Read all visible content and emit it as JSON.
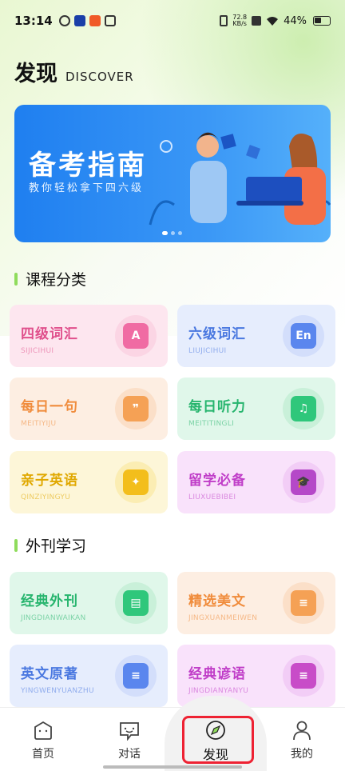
{
  "status": {
    "time": "13:14",
    "net_top": "72.8",
    "net_bottom": "KB/s",
    "battery": "44%"
  },
  "header": {
    "title": "发现",
    "subtitle": "DISCOVER"
  },
  "banner": {
    "title": "备考指南",
    "subtitle": "教你轻松拿下四六级",
    "active_dot": 1
  },
  "sections": [
    {
      "title": "课程分类"
    },
    {
      "title": "外刊学习"
    }
  ],
  "cards": [
    {
      "title": "四级词汇",
      "sub": "SIJICIHUI",
      "icon_text": "A",
      "color": "#e0508c",
      "bg": "#fde6ef",
      "circle": "#fbd5e4",
      "icon_bg": "#f06ba3",
      "icon": "letter-a-icon"
    },
    {
      "title": "六级词汇",
      "sub": "LIUJICIHUI",
      "icon_text": "En",
      "color": "#4a78e0",
      "bg": "#e6edfd",
      "circle": "#d3defb",
      "icon_bg": "#5a86ee",
      "icon": "english-en-icon"
    },
    {
      "title": "每日一句",
      "sub": "MEITIYIJU",
      "icon_text": "❞",
      "color": "#f08c3c",
      "bg": "#fdeee2",
      "circle": "#fbdfc8",
      "icon_bg": "#f5a155",
      "icon": "quote-icon"
    },
    {
      "title": "每日听力",
      "sub": "MEITITINGLI",
      "icon_text": "♫",
      "color": "#27b56e",
      "bg": "#e0f7ea",
      "circle": "#c9f0d9",
      "icon_bg": "#2fc77b",
      "icon": "headphones-icon"
    },
    {
      "title": "亲子英语",
      "sub": "QINZIYINGYU",
      "icon_text": "✦",
      "color": "#e0a800",
      "bg": "#fdf6d8",
      "circle": "#fbedb3",
      "icon_bg": "#f3be1c",
      "icon": "parent-child-icon"
    },
    {
      "title": "留学必备",
      "sub": "LIUXUEBIBEI",
      "icon_text": "🎓",
      "color": "#c03ec8",
      "bg": "#f9e2fb",
      "circle": "#f2cdf6",
      "icon_bg": "#b548c8",
      "icon": "graduation-cap-icon"
    },
    {
      "title": "经典外刊",
      "sub": "JINGDIANWAIKAN",
      "icon_text": "▤",
      "color": "#27b56e",
      "bg": "#e0f7ea",
      "circle": "#c9f0d9",
      "icon_bg": "#2fc77b",
      "icon": "open-book-icon"
    },
    {
      "title": "精选美文",
      "sub": "JINGXUANMEIWEN",
      "icon_text": "≡",
      "color": "#f08c3c",
      "bg": "#fdeee2",
      "circle": "#fbdfc8",
      "icon_bg": "#f5a155",
      "icon": "article-icon"
    },
    {
      "title": "英文原著",
      "sub": "YINGWENYUANZHU",
      "icon_text": "≡",
      "color": "#4a78e0",
      "bg": "#e6edfd",
      "circle": "#d3defb",
      "icon_bg": "#5a86ee",
      "icon": "document-icon"
    },
    {
      "title": "经典谚语",
      "sub": "JINGDIANYANYU",
      "icon_text": "≡",
      "color": "#c03ec8",
      "bg": "#f9e2fb",
      "circle": "#f2cdf6",
      "icon_bg": "#c84cc8",
      "icon": "proverb-book-icon"
    }
  ],
  "tabs": [
    {
      "label": "首页",
      "icon": "home-face-icon"
    },
    {
      "label": "对话",
      "icon": "chat-icon"
    },
    {
      "label": "发现",
      "icon": "compass-icon",
      "active": true
    },
    {
      "label": "我的",
      "icon": "person-icon"
    }
  ],
  "colors": {
    "accent_green": "#8fdc5c",
    "banner_blue": "#1f7ff0",
    "highlight_red": "#e22233"
  }
}
